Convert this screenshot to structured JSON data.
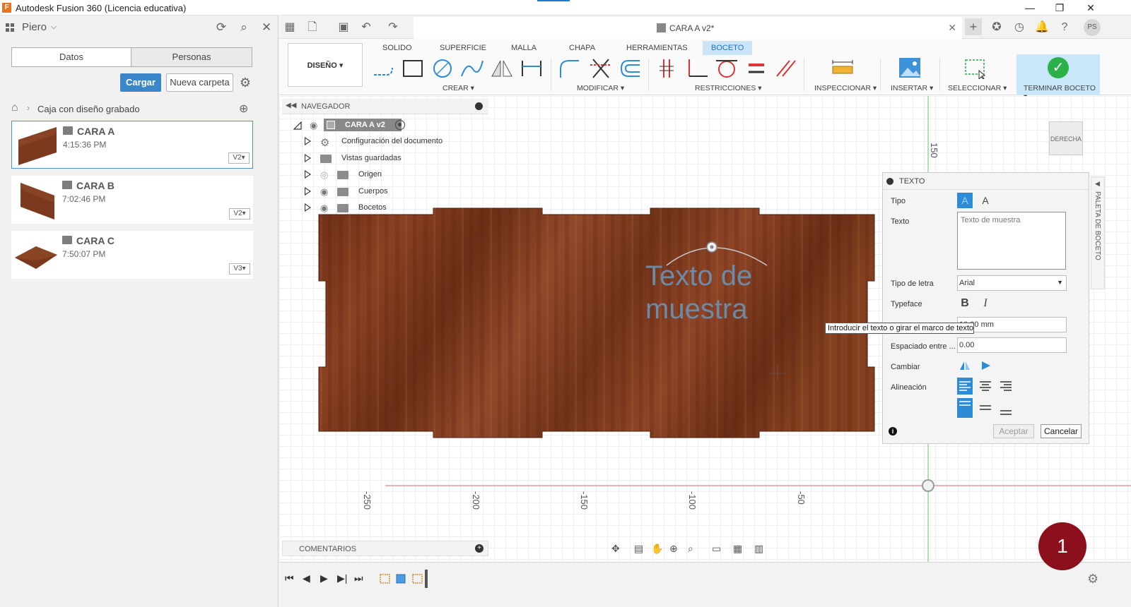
{
  "window": {
    "title": "Autodesk Fusion 360 (Licencia educativa)"
  },
  "data_panel": {
    "user": "Piero",
    "tabs": [
      "Datos",
      "Personas"
    ],
    "upload_label": "Cargar",
    "new_folder_label": "Nueva carpeta",
    "breadcrumb": "Caja con diseño grabado",
    "files": [
      {
        "name": "CARA A",
        "time": "4:15:36 PM",
        "version": "V2"
      },
      {
        "name": "CARA B",
        "time": "7:02:46 PM",
        "version": "V2"
      },
      {
        "name": "CARA C",
        "time": "7:50:07 PM",
        "version": "V3"
      }
    ]
  },
  "doc_tab": {
    "name": "CARA A v2*"
  },
  "ribbon": {
    "workspace": "DISEÑO ▾",
    "tabs": [
      "SOLIDO",
      "SUPERFICIE",
      "MALLA",
      "CHAPA",
      "HERRAMIENTAS",
      "BOCETO"
    ],
    "groups": {
      "create": "CREAR ▾",
      "modify": "MODIFICAR ▾",
      "constraints": "RESTRICCIONES ▾",
      "inspect": "INSPECCIONAR ▾",
      "insert": "INSERTAR ▾",
      "select": "SELECCIONAR ▾",
      "finish": "TERMINAR BOCETO ▾"
    }
  },
  "browser": {
    "title": "NAVEGADOR",
    "root": "CARA A v2",
    "items": [
      "Configuración del documento",
      "Vistas guardadas",
      "Origen",
      "Cuerpos",
      "Bocetos"
    ]
  },
  "canvas": {
    "sample_text_line1": "Texto de",
    "sample_text_line2": "muestra",
    "ruler_labels": [
      "-250",
      "-200",
      "-150",
      "-100",
      "-50"
    ],
    "vertical_ruler_label": "150",
    "viewcube_label": "DERECHA"
  },
  "text_panel": {
    "title": "TEXTO",
    "type_label": "Tipo",
    "text_label": "Texto",
    "text_value": "Texto de muestra",
    "font_label": "Tipo de letra",
    "font_value": "Arial",
    "typeface_label": "Typeface",
    "height_value": "10.00 mm",
    "spacing_label": "Espaciado entre ...",
    "spacing_value": "0.00",
    "flip_label": "Cambiar",
    "align_label": "Alineación",
    "accept_label": "Aceptar",
    "cancel_label": "Cancelar"
  },
  "tooltip": "Introducir el texto o girar el marco de texto",
  "comments_label": "COMENTARIOS",
  "side_palette_label": "PALETA DE BOCETO",
  "badge_number": "1"
}
